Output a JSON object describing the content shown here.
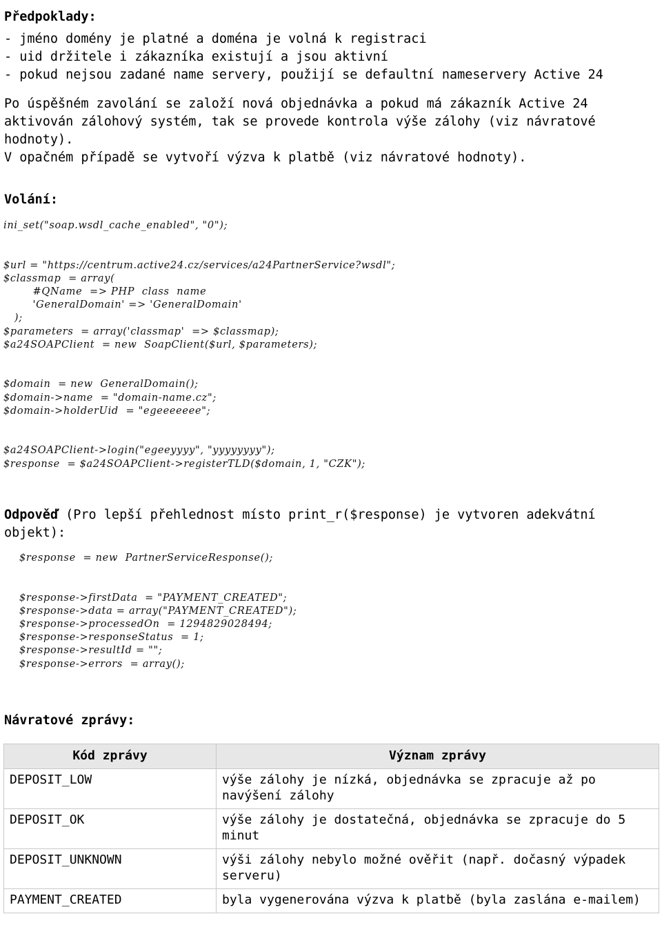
{
  "document": {
    "sections": {
      "assumptions_heading": "Předpoklady:",
      "assumptions_list": "- jméno domény je platné a doména je volná k registraci\n- uid držitele i zákazníka existují a jsou aktivní\n- pokud nejsou zadané name servery, použijí se defaultní nameservery Active 24",
      "flow_paragraph": "Po úspěšném zavolání se založí nová objednávka a pokud má zákazník Active 24\naktivován zálohový systém, tak se provede kontrola výše zálohy (viz návratové\nhodnoty).\nV opačném případě se vytvoří výzva k platbě (viz návratové hodnoty).",
      "call_heading": "Volání:",
      "call_code": "ini_set(\"soap.wsdl_cache_enabled\", \"0\");\n\n\n$url = \"https://centrum.active24.cz/services/a24PartnerService?wsdl\";\n$classmap  = array(\n        #QName  => PHP  class  name\n        'GeneralDomain' => 'GeneralDomain'\n   );\n$parameters  = array('classmap'  => $classmap);\n$a24SOAPClient  = new  SoapClient($url, $parameters);\n\n\n$domain  = new  GeneralDomain();\n$domain->name  = \"domain-name.cz\";\n$domain->holderUid  = \"egeeeeeee\";\n\n\n$a24SOAPClient->login(\"egeeyyyy\", \"yyyyyyyy\");\n$response  = $a24SOAPClient->registerTLD($domain, 1, \"CZK\");",
      "response_heading_bold": "Odpověď",
      "response_heading_rest": " (Pro lepší přehlednost místo print_r($response) je vytvoren adekvátní objekt):",
      "response_code": "$response  = new  PartnerServiceResponse();\n\n\n$response->firstData  = \"PAYMENT_CREATED\";\n$response->data = array(\"PAYMENT_CREATED\");\n$response->processedOn  = 1294829028494;\n$response->responseStatus  = 1;\n$response->resultId = \"\";\n$response->errors  = array();",
      "return_messages_heading": "Návratové zprávy:"
    },
    "messages_table": {
      "columns": [
        "Kód zprávy",
        "Význam zprávy"
      ],
      "rows": [
        {
          "code": "DEPOSIT_LOW",
          "meaning": "výše zálohy je nízká, objednávka se zpracuje až po navýšení zálohy"
        },
        {
          "code": "DEPOSIT_OK",
          "meaning": "výše zálohy je dostatečná, objednávka se zpracuje do 5 minut"
        },
        {
          "code": "DEPOSIT_UNKNOWN",
          "meaning": "výši zálohy nebylo možné ověřit (např. dočasný výpadek serveru)"
        },
        {
          "code": "PAYMENT_CREATED",
          "meaning": "byla vygenerována výzva k platbě (byla zaslána e-mailem)"
        }
      ]
    },
    "colors": {
      "page_background": "#ffffff",
      "text": "#000000",
      "table_header_background": "#e7e7e7",
      "table_border": "#c8c8c8"
    }
  }
}
